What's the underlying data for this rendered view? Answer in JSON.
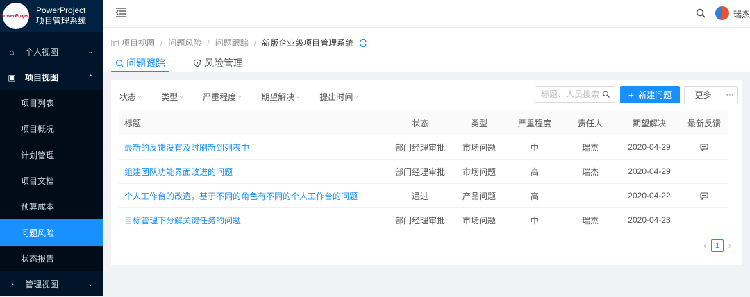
{
  "brand": {
    "badge": "PowerProject",
    "title_line1": "PowerProject",
    "title_line2": "项目管理系统"
  },
  "sidebar": {
    "groups": [
      {
        "label": "个人视图",
        "icon": "home-icon"
      },
      {
        "label": "项目视图",
        "icon": "project-icon"
      },
      {
        "label": "管理视图",
        "icon": "dashboard-icon"
      }
    ],
    "project_items": [
      {
        "label": "项目列表"
      },
      {
        "label": "项目概况"
      },
      {
        "label": "计划管理"
      },
      {
        "label": "项目文档"
      },
      {
        "label": "预算成本"
      },
      {
        "label": "问题风险"
      },
      {
        "label": "状态报告"
      }
    ]
  },
  "topbar": {
    "user_name": "瑞杰"
  },
  "breadcrumb": [
    "项目视图",
    "问题风险",
    "问题跟踪",
    "新版企业级项目管理系统"
  ],
  "tabs": [
    {
      "label": "问题跟踪",
      "icon": "search-issue-icon"
    },
    {
      "label": "风险管理",
      "icon": "shield-icon"
    }
  ],
  "filters": [
    "状态",
    "类型",
    "严重程度",
    "期望解决",
    "提出时间"
  ],
  "search": {
    "placeholder": "标题、人员搜索"
  },
  "actions": {
    "new_label": "新建问题",
    "more_label": "更多",
    "dots_label": "···"
  },
  "table": {
    "columns": [
      "标题",
      "状态",
      "类型",
      "严重程度",
      "责任人",
      "期望解决",
      "最新反馈"
    ],
    "rows": [
      {
        "title": "最新的反馈没有及时刷新到列表中",
        "status": "部门经理审批",
        "type": "市场问题",
        "severity": "中",
        "owner": "瑞杰",
        "due": "2020-04-29",
        "feedback": true
      },
      {
        "title": "组建团队功能界面改进的问题",
        "status": "部门经理审批",
        "type": "市场问题",
        "severity": "高",
        "owner": "瑞杰",
        "due": "2020-04-29",
        "feedback": false
      },
      {
        "title": "个人工作台的改造，基于不同的角色有不同的个人工作台的问题",
        "status": "通过",
        "type": "产品问题",
        "severity": "高",
        "owner": "",
        "due": "2020-04-22",
        "feedback": true
      },
      {
        "title": "目标管理下分解关键任务的问题",
        "status": "部门经理审批",
        "type": "市场问题",
        "severity": "中",
        "owner": "瑞杰",
        "due": "2020-04-23",
        "feedback": false
      }
    ]
  },
  "pager": {
    "current": "1",
    "prev": "‹",
    "next": "›"
  },
  "colors": {
    "accent": "#1890ff",
    "sidebar": "#001529"
  }
}
